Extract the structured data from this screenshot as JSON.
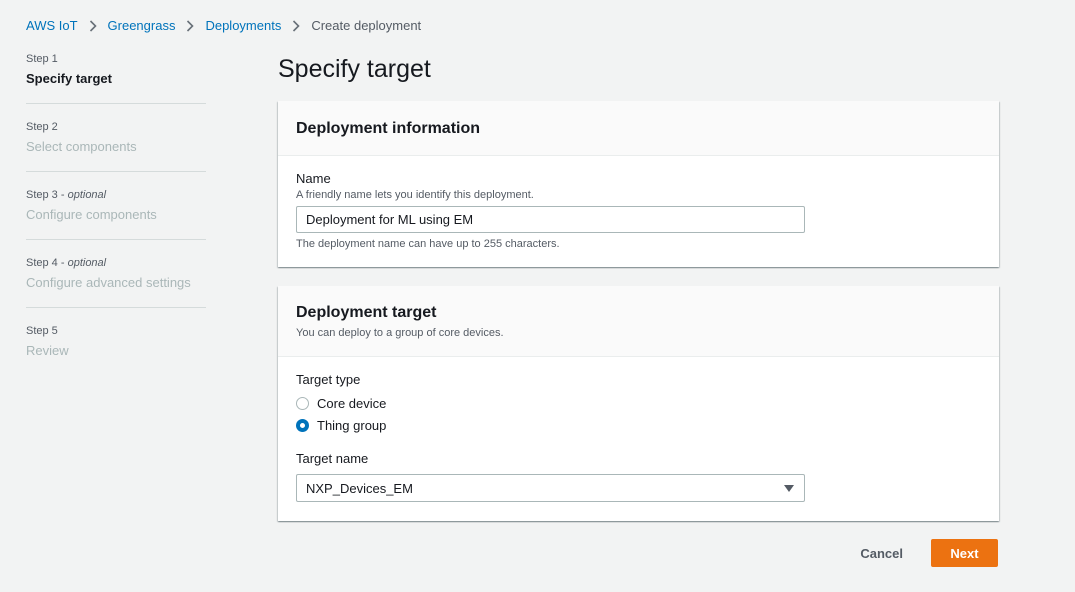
{
  "breadcrumb": {
    "items": [
      "AWS IoT",
      "Greengrass",
      "Deployments"
    ],
    "current": "Create deployment"
  },
  "steps": [
    {
      "num": "Step 1",
      "optional": "",
      "label": "Specify target"
    },
    {
      "num": "Step 2",
      "optional": "",
      "label": "Select components"
    },
    {
      "num": "Step 3 - ",
      "optional": "optional",
      "label": "Configure components"
    },
    {
      "num": "Step 4 - ",
      "optional": "optional",
      "label": "Configure advanced settings"
    },
    {
      "num": "Step 5",
      "optional": "",
      "label": "Review"
    }
  ],
  "page_title": "Specify target",
  "deployment_info": {
    "title": "Deployment information",
    "name_label": "Name",
    "name_desc": "A friendly name lets you identify this deployment.",
    "name_value": "Deployment for ML using EM",
    "name_constraint": "The deployment name can have up to 255 characters."
  },
  "deployment_target": {
    "title": "Deployment target",
    "desc": "You can deploy to a group of core devices.",
    "target_type_label": "Target type",
    "options": [
      "Core device",
      "Thing group"
    ],
    "selected": "Thing group",
    "target_name_label": "Target name",
    "target_name_value": "NXP_Devices_EM"
  },
  "actions": {
    "cancel": "Cancel",
    "next": "Next"
  },
  "colors": {
    "link": "#0073bb",
    "primary_button": "#ec7211",
    "background": "#f2f3f3"
  }
}
